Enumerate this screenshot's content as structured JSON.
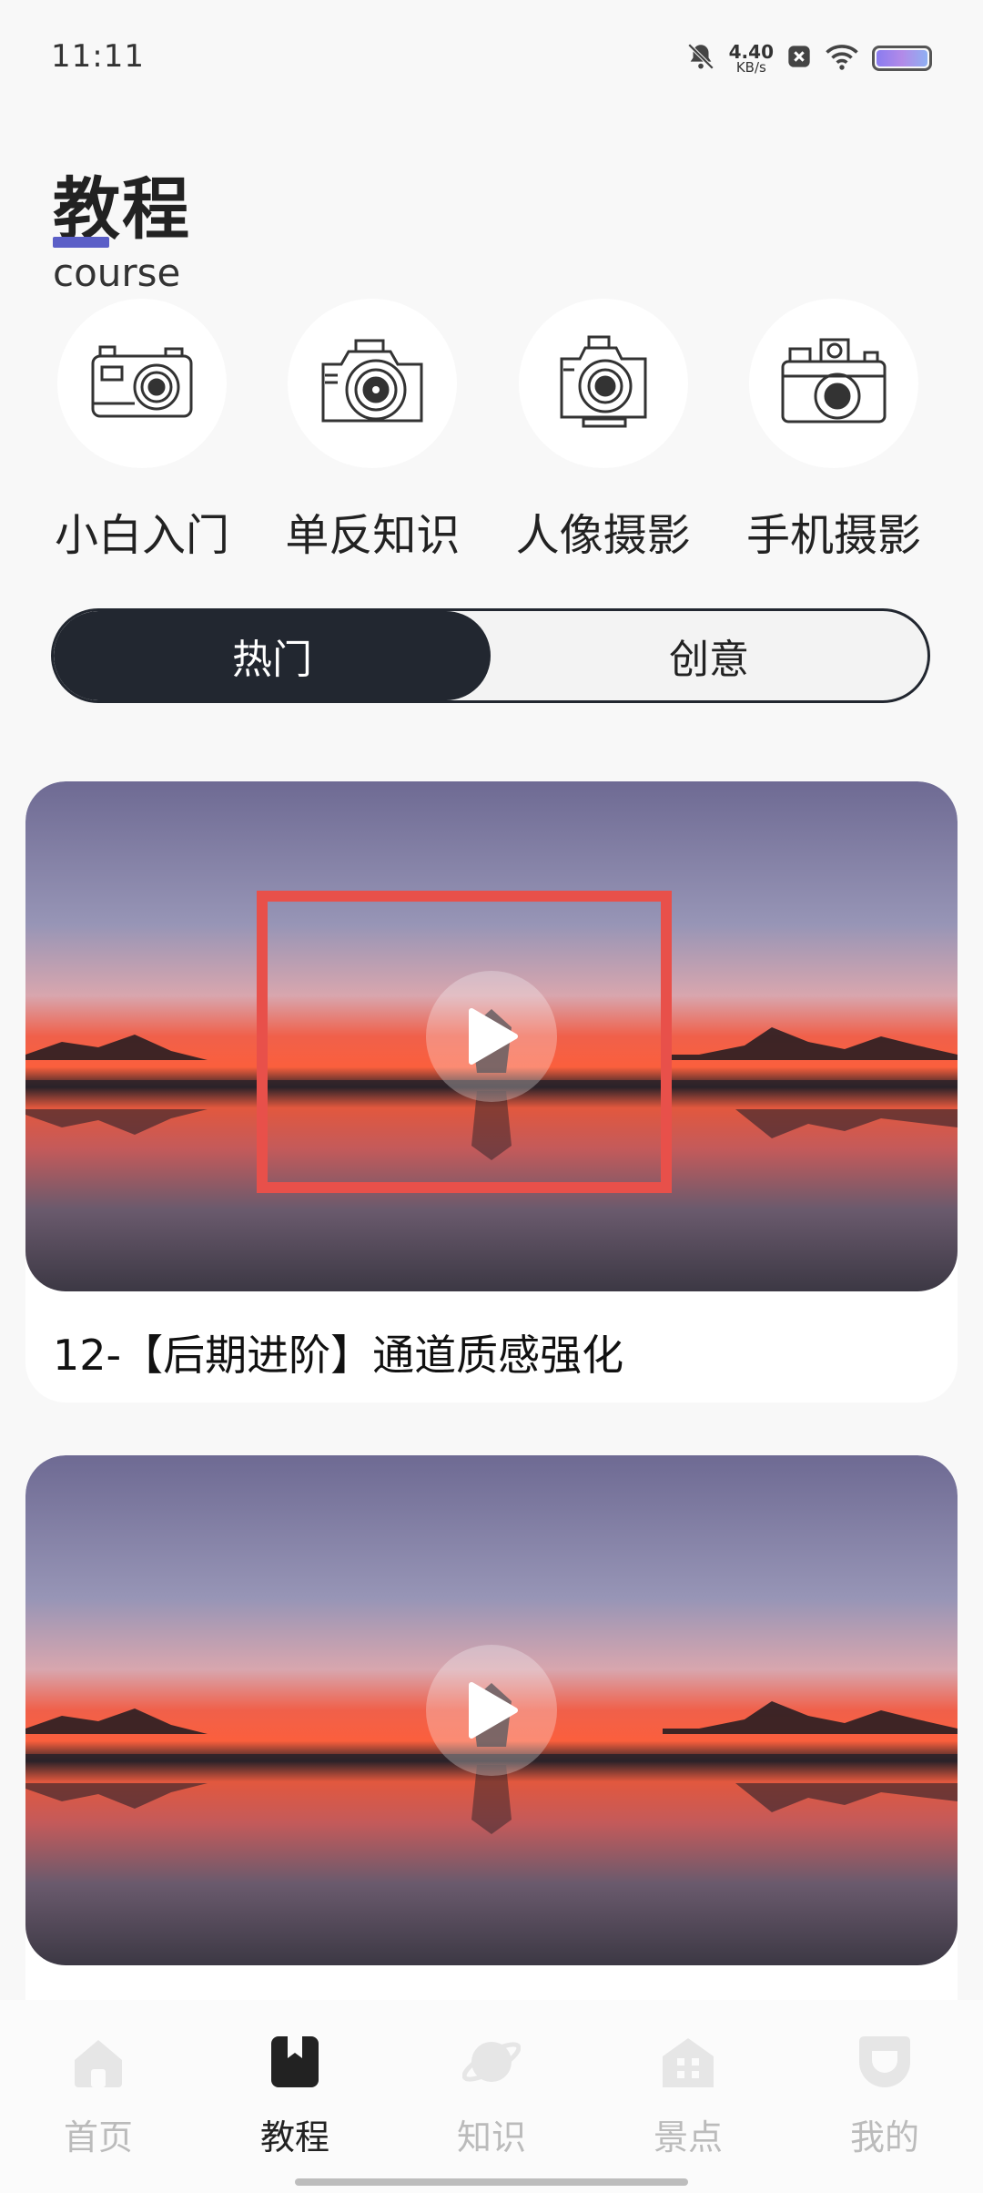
{
  "status_bar": {
    "time": "11:11",
    "net_speed_value": "4.40",
    "net_speed_unit": "KB/s",
    "icons": [
      "bell-muted-icon",
      "close-box-icon",
      "wifi-icon",
      "battery-icon"
    ]
  },
  "header": {
    "title": "教程",
    "subtitle": "course",
    "accent_color": "#5b5fc7"
  },
  "categories": [
    {
      "label": "小白入门",
      "icon": "compact-camera-icon"
    },
    {
      "label": "单反知识",
      "icon": "dslr-camera-icon"
    },
    {
      "label": "人像摄影",
      "icon": "portrait-camera-icon"
    },
    {
      "label": "手机摄影",
      "icon": "retro-camera-icon"
    }
  ],
  "tabs": [
    {
      "label": "热门",
      "active": true
    },
    {
      "label": "创意",
      "active": false
    }
  ],
  "videos": [
    {
      "title": "12-【后期进阶】通道质感强化",
      "icon": "play-icon"
    },
    {
      "title": "",
      "icon": "play-icon"
    }
  ],
  "bottom_nav": [
    {
      "label": "首页",
      "icon": "home-icon",
      "active": false
    },
    {
      "label": "教程",
      "icon": "bookmark-book-icon",
      "active": true
    },
    {
      "label": "知识",
      "icon": "planet-icon",
      "active": false
    },
    {
      "label": "景点",
      "icon": "building-icon",
      "active": false
    },
    {
      "label": "我的",
      "icon": "profile-face-icon",
      "active": false
    }
  ],
  "colors": {
    "tab_active_bg": "#222730",
    "highlight_box": "#e8504a",
    "nav_inactive": "#bbbbbb"
  }
}
